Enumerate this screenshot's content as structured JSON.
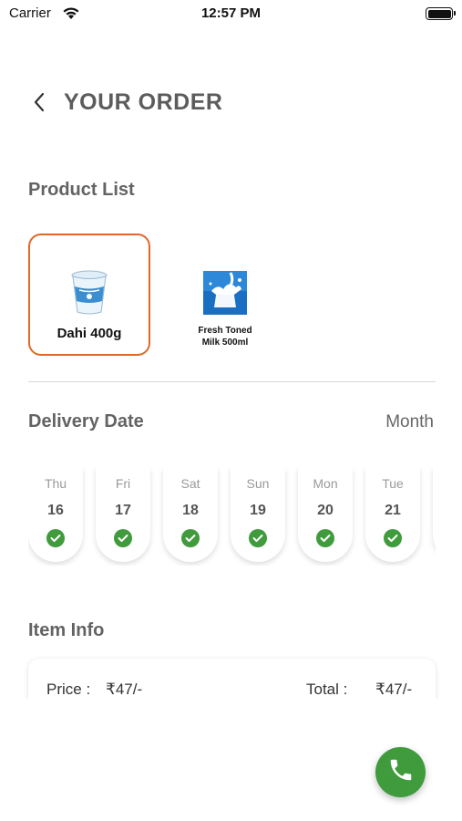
{
  "status_bar": {
    "carrier": "Carrier",
    "time": "12:57 PM"
  },
  "header": {
    "title": "YOUR ORDER",
    "back_icon": "chevron-left-icon"
  },
  "product_list": {
    "title": "Product List",
    "items": [
      {
        "name": "Dahi 400g",
        "icon": "yogurt-cup-icon",
        "selected": true
      },
      {
        "name": "Fresh Toned Milk 500ml",
        "icon": "milk-splash-icon",
        "selected": false
      }
    ]
  },
  "delivery": {
    "title": "Delivery Date",
    "month_label": "Month",
    "dates": [
      {
        "day": "Thu",
        "date": "16",
        "delivered": true
      },
      {
        "day": "Fri",
        "date": "17",
        "delivered": true
      },
      {
        "day": "Sat",
        "date": "18",
        "delivered": true
      },
      {
        "day": "Sun",
        "date": "19",
        "delivered": true
      },
      {
        "day": "Mon",
        "date": "20",
        "delivered": true
      },
      {
        "day": "Tue",
        "date": "21",
        "delivered": true
      }
    ]
  },
  "item_info": {
    "title": "Item Info",
    "price_label": "Price :",
    "price_value": "₹47/-",
    "total_label": "Total :",
    "total_value": "₹47/-"
  },
  "call_button": {
    "icon": "phone-icon"
  },
  "colors": {
    "accent": "#e0672a",
    "success": "#3f9b3c"
  }
}
